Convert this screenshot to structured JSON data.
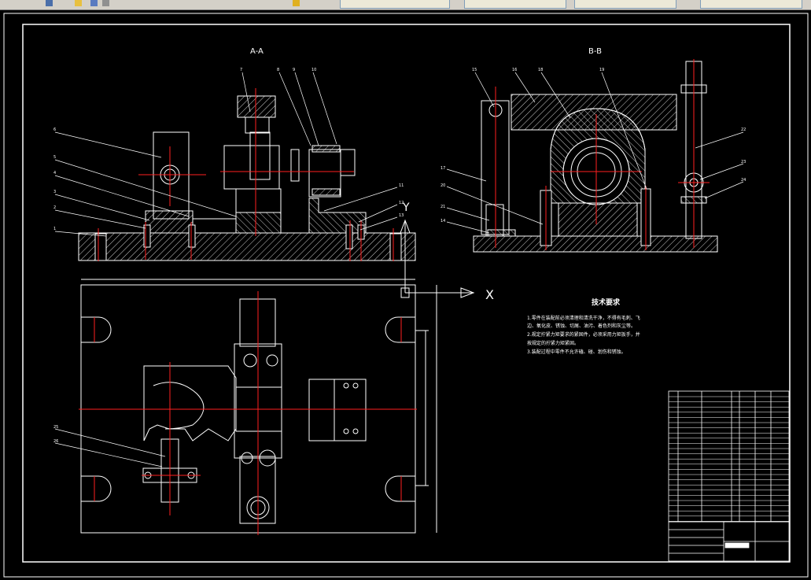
{
  "toolbar": {
    "tabs": [
      "",
      "",
      "",
      ""
    ],
    "search_placeholder": ""
  },
  "drawing": {
    "view_a_label": "A-A",
    "view_b_label": "B-B",
    "axis_x": "X",
    "axis_y": "Y",
    "tech_title": "技术要求",
    "tech_lines": [
      "1.零件在装配前必须清理和清洗干净，不得有毛刺、飞",
      "边、氧化皮、锈蚀、切屑、油污、着色剂和灰尘等。",
      "2.规定拧紧力矩要求的紧固件，必须采用力矩扳手，并",
      "按规定的拧紧力矩紧固。",
      "3.装配过程中零件不允许磕、碰、划伤和锈蚀。"
    ],
    "callouts_a": [
      "7",
      "8",
      "9",
      "10",
      "6",
      "5",
      "4",
      "3",
      "2",
      "1",
      "11",
      "12",
      "13"
    ],
    "callouts_b": [
      "15",
      "16",
      "18",
      "19",
      "17",
      "20",
      "21",
      "14",
      "22",
      "23",
      "24"
    ],
    "callouts_plan": [
      "25",
      "26"
    ],
    "colors": {
      "outline": "#ffffff",
      "centerline": "#ff0000",
      "hatch": "#ffffff",
      "background": "#000000"
    }
  }
}
